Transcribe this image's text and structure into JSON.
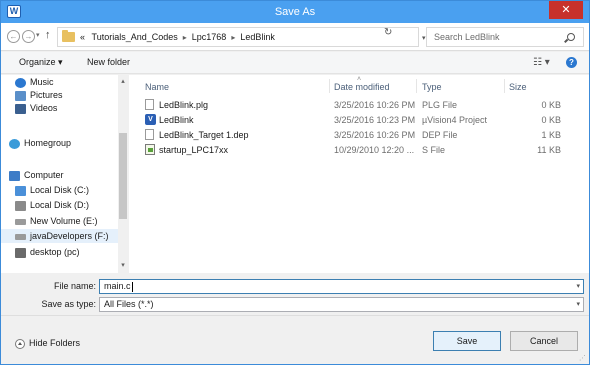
{
  "window": {
    "title": "Save As",
    "app_icon_glyph": "W",
    "close_glyph": "✕"
  },
  "nav": {
    "back_glyph": "←",
    "forward_glyph": "→",
    "dropdown_glyph": "▾",
    "up_glyph": "↑",
    "overflow_glyph": "«",
    "crumbs": [
      "Tutorials_And_Codes",
      "Lpc1768",
      "LedBlink"
    ],
    "crumb_sep_glyph": "▸",
    "refresh_glyph": "↻",
    "search_placeholder": "Search LedBlink"
  },
  "toolbar": {
    "organize_label": "Organize ▾",
    "new_folder_label": "New folder",
    "view_glyph": "☷ ▾",
    "help_glyph": "?"
  },
  "tree": {
    "items": [
      {
        "label": "Music",
        "icon": "music-icon",
        "color": "#2b78d0"
      },
      {
        "label": "Pictures",
        "icon": "pictures-icon",
        "color": "#5a8fc9"
      },
      {
        "label": "Videos",
        "icon": "videos-icon",
        "color": "#3a5f8f"
      },
      {
        "label": "Homegroup",
        "icon": "homegroup-icon",
        "color": "#3a9bd9"
      },
      {
        "label": "Computer",
        "icon": "computer-icon",
        "color": "#3d7cc7"
      },
      {
        "label": "Local Disk (C:)",
        "icon": "disk-c-icon",
        "color": "#4a90d9"
      },
      {
        "label": "Local Disk (D:)",
        "icon": "disk-d-icon",
        "color": "#8a8a8a"
      },
      {
        "label": "New Volume (E:)",
        "icon": "volume-e-icon",
        "color": "#9a9a9a"
      },
      {
        "label": "javaDevelopers (F:)",
        "icon": "drive-f-icon",
        "color": "#9a9a9a"
      },
      {
        "label": "desktop (pc)",
        "icon": "network-drive-icon",
        "color": "#6a6a6a"
      }
    ],
    "scroll_up_glyph": "▴",
    "scroll_down_glyph": "▾"
  },
  "filelist": {
    "columns": {
      "name": "Name",
      "date": "Date modified",
      "type": "Type",
      "size": "Size"
    },
    "sort_glyph": "˄",
    "rows": [
      {
        "name": "LedBlink.plg",
        "date": "3/25/2016 10:26 PM",
        "type": "PLG File",
        "size": "0 KB",
        "icon": "file-icon"
      },
      {
        "name": "LedBlink",
        "date": "3/25/2016 10:23 PM",
        "type": "µVision4 Project",
        "size": "0 KB",
        "icon": "uvision-project-icon"
      },
      {
        "name": "LedBlink_Target 1.dep",
        "date": "3/25/2016 10:26 PM",
        "type": "DEP File",
        "size": "1 KB",
        "icon": "file-icon"
      },
      {
        "name": "startup_LPC17xx",
        "date": "10/29/2010 12:20 ...",
        "type": "S File",
        "size": "11 KB",
        "icon": "s-file-icon"
      }
    ]
  },
  "form": {
    "file_name_label": "File name:",
    "file_name_value": "main.c",
    "save_type_label": "Save as type:",
    "save_type_value": "All Files (*.*)",
    "dropdown_glyph": "▾"
  },
  "footer": {
    "hide_folders_label": "Hide Folders",
    "save_label": "Save",
    "cancel_label": "Cancel",
    "grip_glyph": "⋰"
  }
}
